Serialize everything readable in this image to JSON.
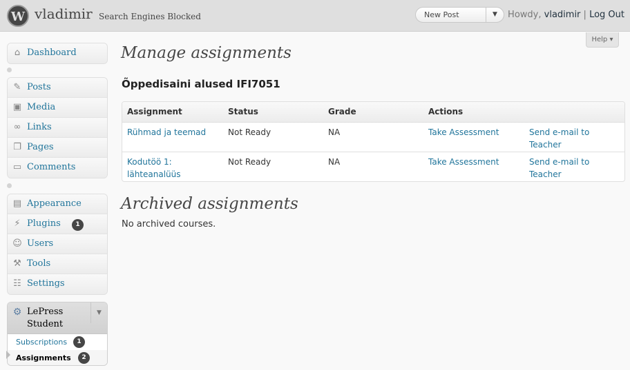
{
  "header": {
    "site_name": "vladimir",
    "site_status": "Search Engines Blocked",
    "favorite_action": "New Post",
    "howdy": "Howdy,",
    "username": "vladimir",
    "separator": "|",
    "logout": "Log Out",
    "help": "Help"
  },
  "menu": {
    "dashboard": "Dashboard",
    "posts": "Posts",
    "media": "Media",
    "links": "Links",
    "pages": "Pages",
    "comments": "Comments",
    "appearance": "Appearance",
    "plugins": "Plugins",
    "plugins_count": "1",
    "users": "Users",
    "tools": "Tools",
    "settings": "Settings",
    "lepress_line1": "LePress",
    "lepress_line2": "Student",
    "subscriptions": "Subscriptions",
    "subscriptions_count": "1",
    "assignments": "Assignments",
    "assignments_count": "2"
  },
  "main": {
    "page_title": "Manage assignments",
    "course_title": "Õppedisaini alused IFI7051",
    "table": {
      "headers": [
        "Assignment",
        "Status",
        "Grade",
        "Actions"
      ],
      "rows": [
        {
          "assignment": "Rühmad ja teemad",
          "status": "Not Ready",
          "grade": "NA",
          "action1": "Take Assessment",
          "action2": "Send e-mail to Teacher"
        },
        {
          "assignment": "Kodutöö 1: lähteanalüüs",
          "status": "Not Ready",
          "grade": "NA",
          "action1": "Take Assessment",
          "action2": "Send e-mail to Teacher"
        }
      ]
    },
    "archive_title": "Archived assignments",
    "archive_empty": "No archived courses."
  },
  "colors": {
    "link": "#21759b",
    "header_bg": "#dfdfdf",
    "badge": "#464646"
  }
}
